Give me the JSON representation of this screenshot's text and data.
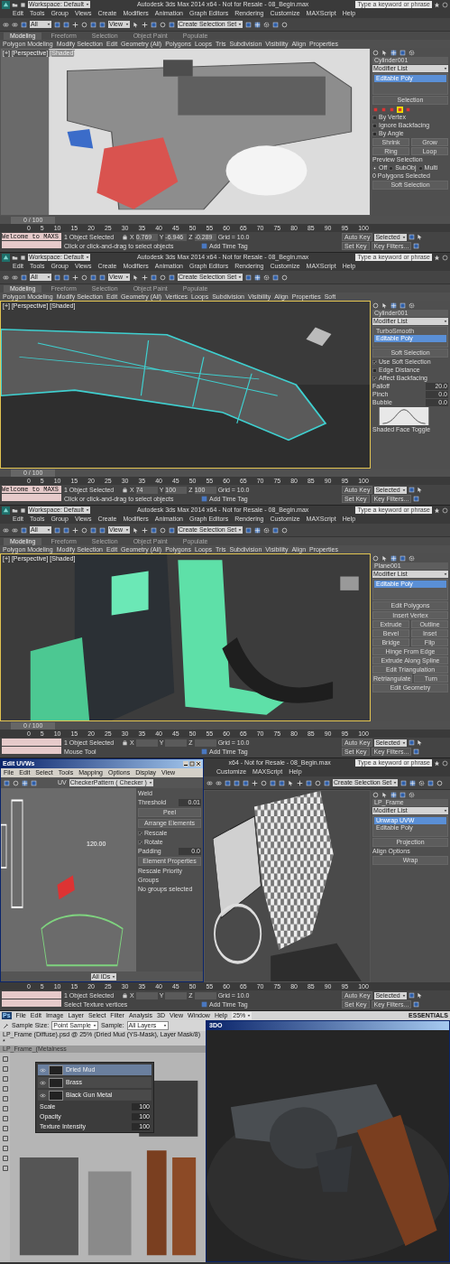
{
  "panels": [
    {
      "kind": "max",
      "title": {
        "workspace": "Workspace: Default",
        "text": "Autodesk 3ds Max 2014 x64 - Not for Resale - 08_Begin.max",
        "search": "Type a keyword or phrase"
      },
      "menu": [
        "Edit",
        "Tools",
        "Group",
        "Views",
        "Create",
        "Modifiers",
        "Animation",
        "Graph Editors",
        "Rendering",
        "Customize",
        "MAXScript",
        "Help"
      ],
      "toolbar": {
        "filter": "All",
        "view": "View",
        "selection_set": "Create Selection Set"
      },
      "ribbon": {
        "tabs": [
          {
            "label": "Modeling",
            "selected": true
          },
          {
            "label": "Freeform",
            "selected": false
          },
          {
            "label": "Selection",
            "selected": false
          },
          {
            "label": "Object Paint",
            "selected": false
          },
          {
            "label": "Populate",
            "selected": false
          }
        ],
        "items": [
          "Polygon Modeling",
          "Modify Selection",
          "Edit",
          "Geometry (All)",
          "Polygons",
          "Loops",
          "Tris",
          "Subdivision",
          "Visibility",
          "Align",
          "Properties"
        ]
      },
      "viewport": {
        "label": "[+] [Perspective] [Shaded]",
        "active": false
      },
      "command": {
        "rows": [
          {
            "kind": "field",
            "value": "Cylinder001"
          },
          {
            "kind": "dropdown",
            "value": "Modifier List"
          },
          {
            "kind": "stack",
            "items": [
              {
                "label": "Editable Poly",
                "selected": true
              }
            ]
          },
          {
            "kind": "rollout",
            "label": "Selection"
          },
          {
            "kind": "subobject",
            "items": [
              {
                "selected": false
              },
              {
                "selected": false
              },
              {
                "selected": false
              },
              {
                "selected": true
              },
              {
                "selected": false
              }
            ]
          },
          {
            "kind": "check",
            "label": "By Vertex",
            "checked": false
          },
          {
            "kind": "check",
            "label": "Ignore Backfacing",
            "checked": false
          },
          {
            "kind": "check",
            "label": "By Angle",
            "checked": false
          },
          {
            "kind": "buttons",
            "labels": [
              "Shrink",
              "Grow"
            ]
          },
          {
            "kind": "buttons",
            "labels": [
              "Ring",
              "Loop"
            ]
          },
          {
            "kind": "text",
            "label": "Preview Selection"
          },
          {
            "kind": "radios",
            "options": [
              {
                "label": "Off",
                "selected": true
              },
              {
                "label": "SubObj",
                "selected": false
              },
              {
                "label": "Multi",
                "selected": false
              }
            ]
          },
          {
            "kind": "text",
            "label": "0 Polygons Selected"
          },
          {
            "kind": "rollout",
            "label": "Soft Selection"
          }
        ]
      },
      "timeline": {
        "frame": "0 / 100",
        "ticks": [
          "0",
          "5",
          "10",
          "15",
          "20",
          "25",
          "30",
          "35",
          "40",
          "45",
          "50",
          "55",
          "60",
          "65",
          "70",
          "75",
          "80",
          "85",
          "90",
          "95",
          "100"
        ]
      },
      "status": {
        "listener": "Welcome to MAXS",
        "selected": "1 Object Selected",
        "prompt": "Click or click-and-drag to select objects",
        "coords": [
          {
            "axis": "X",
            "value": "0.769"
          },
          {
            "axis": "Y",
            "value": "-6.946"
          },
          {
            "axis": "Z",
            "value": "-0.289"
          }
        ],
        "grid": "Grid = 10.0",
        "time_tag": "Add Time Tag",
        "auto_key": "Auto Key",
        "key_mode": "Selected",
        "set_key": "Set Key",
        "key_filters": "Key Filters..."
      }
    },
    {
      "kind": "max",
      "title": {
        "workspace": "Workspace: Default",
        "text": "Autodesk 3ds Max 2014 x64 - Not for Resale - 08_Begin.max",
        "search": "Type a keyword or phrase"
      },
      "menu": [
        "Edit",
        "Tools",
        "Group",
        "Views",
        "Create",
        "Modifiers",
        "Animation",
        "Graph Editors",
        "Rendering",
        "Customize",
        "MAXScript",
        "Help"
      ],
      "toolbar": {
        "filter": "All",
        "view": "View",
        "selection_set": "Create Selection Set"
      },
      "ribbon": {
        "tabs": [
          {
            "label": "Modeling",
            "selected": true
          },
          {
            "label": "Freeform",
            "selected": false
          },
          {
            "label": "Selection",
            "selected": false
          },
          {
            "label": "Object Paint",
            "selected": false
          },
          {
            "label": "Populate",
            "selected": false
          }
        ],
        "items": [
          "Polygon Modeling",
          "Modify Selection",
          "Edit",
          "Geometry (All)",
          "Vertices",
          "Loops",
          "Subdivision",
          "Visibility",
          "Align",
          "Properties",
          "Soft"
        ]
      },
      "viewport": {
        "label": "[+] [Perspective] [Shaded]",
        "active": true
      },
      "command": {
        "rows": [
          {
            "kind": "field",
            "value": "Cylinder001"
          },
          {
            "kind": "dropdown",
            "value": "Modifier List"
          },
          {
            "kind": "stack",
            "items": [
              {
                "label": "TurboSmooth",
                "selected": false
              },
              {
                "label": "Editable Poly",
                "selected": true
              }
            ]
          },
          {
            "kind": "rollout",
            "label": "Soft Selection"
          },
          {
            "kind": "check",
            "label": "Use Soft Selection",
            "checked": true
          },
          {
            "kind": "check",
            "label": "Edge Distance",
            "checked": false
          },
          {
            "kind": "check",
            "label": "Affect Backfacing",
            "checked": true
          },
          {
            "kind": "spinner",
            "label": "Falloff",
            "value": "20.0"
          },
          {
            "kind": "spinner",
            "label": "Pinch",
            "value": "0.0"
          },
          {
            "kind": "spinner",
            "label": "Bubble",
            "value": "0.0"
          },
          {
            "kind": "curve"
          },
          {
            "kind": "text",
            "label": "Shaded Face Toggle"
          }
        ]
      },
      "timeline": {
        "frame": "0 / 100",
        "ticks": [
          "0",
          "5",
          "10",
          "15",
          "20",
          "25",
          "30",
          "35",
          "40",
          "45",
          "50",
          "55",
          "60",
          "65",
          "70",
          "75",
          "80",
          "85",
          "90",
          "95",
          "100"
        ]
      },
      "status": {
        "listener": "Welcome to MAXS",
        "selected": "1 Object Selected",
        "prompt": "Click or click-and-drag to select objects",
        "coords": [
          {
            "axis": "X",
            "value": "74"
          },
          {
            "axis": "Y",
            "value": "100"
          },
          {
            "axis": "Z",
            "value": "100"
          }
        ],
        "grid": "Grid = 10.0",
        "time_tag": "Add Time Tag",
        "auto_key": "Auto Key",
        "key_mode": "Selected",
        "set_key": "Set Key",
        "key_filters": "Key Filters..."
      }
    },
    {
      "kind": "max",
      "title": {
        "workspace": "Workspace: Default",
        "text": "Autodesk 3ds Max 2014 x64 - Not for Resale - 08_Begin.max",
        "search": "Type a keyword or phrase"
      },
      "menu": [
        "Edit",
        "Tools",
        "Group",
        "Views",
        "Create",
        "Modifiers",
        "Animation",
        "Graph Editors",
        "Rendering",
        "Customize",
        "MAXScript",
        "Help"
      ],
      "toolbar": {
        "filter": "All",
        "view": "View",
        "selection_set": "Create Selection Set"
      },
      "ribbon": {
        "tabs": [
          {
            "label": "Modeling",
            "selected": true
          },
          {
            "label": "Freeform",
            "selected": false
          },
          {
            "label": "Selection",
            "selected": false
          },
          {
            "label": "Object Paint",
            "selected": false
          },
          {
            "label": "Populate",
            "selected": false
          }
        ],
        "items": [
          "Polygon Modeling",
          "Modify Selection",
          "Edit",
          "Geometry (All)",
          "Polygons",
          "Loops",
          "Tris",
          "Subdivision",
          "Visibility",
          "Align",
          "Properties"
        ]
      },
      "viewport": {
        "label": "[+] [Perspective] [Shaded]",
        "active": true
      },
      "command": {
        "rows": [
          {
            "kind": "field",
            "value": "Plane001"
          },
          {
            "kind": "dropdown",
            "value": "Modifier List"
          },
          {
            "kind": "stack",
            "items": [
              {
                "label": "Editable Poly",
                "selected": true
              }
            ]
          },
          {
            "kind": "rollout",
            "label": "Edit Polygons"
          },
          {
            "kind": "buttons",
            "labels": [
              "Insert Vertex"
            ]
          },
          {
            "kind": "buttons",
            "labels": [
              "Extrude",
              "Outline"
            ]
          },
          {
            "kind": "buttons",
            "labels": [
              "Bevel",
              "Inset"
            ]
          },
          {
            "kind": "buttons",
            "labels": [
              "Bridge",
              "Flip"
            ]
          },
          {
            "kind": "buttons",
            "labels": [
              "Hinge From Edge"
            ]
          },
          {
            "kind": "buttons",
            "labels": [
              "Extrude Along Spline"
            ]
          },
          {
            "kind": "buttons",
            "labels": [
              "Edit Triangulation"
            ]
          },
          {
            "kind": "buttons",
            "labels": [
              "Retriangulate",
              "Turn"
            ]
          },
          {
            "kind": "rollout",
            "label": "Edit Geometry"
          }
        ]
      },
      "timeline": {
        "frame": "0 / 100",
        "ticks": [
          "0",
          "5",
          "10",
          "15",
          "20",
          "25",
          "30",
          "35",
          "40",
          "45",
          "50",
          "55",
          "60",
          "65",
          "70",
          "75",
          "80",
          "85",
          "90",
          "95",
          "100"
        ]
      },
      "status": {
        "selected": "1 Object Selected",
        "prompt": "Mouse Tool",
        "coords": [
          {
            "axis": "X"
          },
          {
            "axis": "Y"
          },
          {
            "axis": "Z"
          }
        ],
        "grid": "Grid = 10.0",
        "time_tag": "Add Time Tag",
        "auto_key": "Auto Key",
        "key_mode": "Selected",
        "set_key": "Set Key",
        "key_filters": "Key Filters..."
      }
    },
    {
      "kind": "max",
      "title": {
        "text": "x64 - Not for Resale - 08_Begin.max",
        "search": "Type a keyword or phrase"
      },
      "menu": [
        "Customize",
        "MAXScript",
        "Help"
      ],
      "toolbar": {
        "selection_set": "Create Selection Set"
      },
      "viewport": {
        "active": false
      },
      "uvw_editor": {
        "title": "Edit UVWs",
        "menu": [
          "File",
          "Edit",
          "Select",
          "Tools",
          "Mapping",
          "Options",
          "Display",
          "View"
        ],
        "uv": "UV",
        "texture": "CheckerPattern ( Checker )",
        "measure": "120.00",
        "rows": [
          {
            "kind": "text",
            "label": "Weld"
          },
          {
            "kind": "spinner",
            "label": "Threshold",
            "value": "0.01"
          },
          {
            "kind": "rollout",
            "label": "Peel"
          },
          {
            "kind": "rollout",
            "label": "Arrange Elements"
          },
          {
            "kind": "check",
            "label": "Rescale",
            "checked": true
          },
          {
            "kind": "check",
            "label": "Rotate",
            "checked": true
          },
          {
            "kind": "spinner",
            "label": "Padding",
            "value": "0.0"
          },
          {
            "kind": "rollout",
            "label": "Element Properties"
          },
          {
            "kind": "text",
            "label": "Rescale Priority"
          },
          {
            "kind": "text",
            "label": "Groups"
          },
          {
            "kind": "text",
            "label": "No groups selected"
          }
        ],
        "ids": "All IDs"
      },
      "command": {
        "rows": [
          {
            "kind": "field",
            "value": "LP_Frame"
          },
          {
            "kind": "dropdown",
            "value": "Modifier List"
          },
          {
            "kind": "stack",
            "items": [
              {
                "label": "Unwrap UVW",
                "selected": true
              },
              {
                "label": "Editable Poly",
                "selected": false
              }
            ]
          },
          {
            "kind": "rollout",
            "label": "Projection"
          },
          {
            "kind": "text",
            "label": "Align Options"
          },
          {
            "kind": "rollout",
            "label": "Wrap"
          }
        ]
      },
      "timeline": {
        "ticks": [
          "0",
          "5",
          "10",
          "15",
          "20",
          "25",
          "30",
          "35",
          "40",
          "45",
          "50",
          "55",
          "60",
          "65",
          "70",
          "75",
          "80",
          "85",
          "90",
          "95",
          "100"
        ]
      },
      "status": {
        "selected": "1 Object Selected",
        "prompt": "Select Texture vertices",
        "coords": [
          {
            "axis": "X"
          },
          {
            "axis": "Y"
          },
          {
            "axis": "Z"
          }
        ],
        "grid": "Grid = 10.0",
        "time_tag": "Add Time Tag",
        "auto_key": "Auto Key",
        "key_mode": "Selected",
        "set_key": "Set Key",
        "key_filters": "Key Filters..."
      }
    },
    {
      "kind": "photoshop",
      "logo": "Ps",
      "menu": [
        "File",
        "Edit",
        "Image",
        "Layer",
        "Select",
        "Filter",
        "Analysis",
        "3D",
        "View",
        "Window",
        "Help"
      ],
      "zoom": "25%",
      "workspace": "ESSENTIALS",
      "options": {
        "sample_size_label": "Sample Size:",
        "sample_size": "Point Sample",
        "sample_label": "Sample:",
        "sample": "All Layers"
      },
      "doc_tabs": [
        {
          "label": "LP_Frame (Diffuse).psd @ 25% (Dried Mud (YS-Mask), Layer Mask/8) *",
          "selected": true
        },
        {
          "label": "LP_Frame_(Metalness",
          "selected": false
        }
      ],
      "layers": [
        {
          "name": "Dried Mud",
          "selected": true
        },
        {
          "name": "Brass",
          "selected": false
        },
        {
          "name": "Black Gun Metal",
          "selected": false
        }
      ],
      "props": [
        {
          "label": "Scale",
          "value": "100"
        },
        {
          "label": "Opacity",
          "value": "100"
        },
        {
          "label": "Texture Intensity",
          "value": "100"
        }
      ],
      "render_window": {
        "title": "3DO"
      }
    }
  ]
}
